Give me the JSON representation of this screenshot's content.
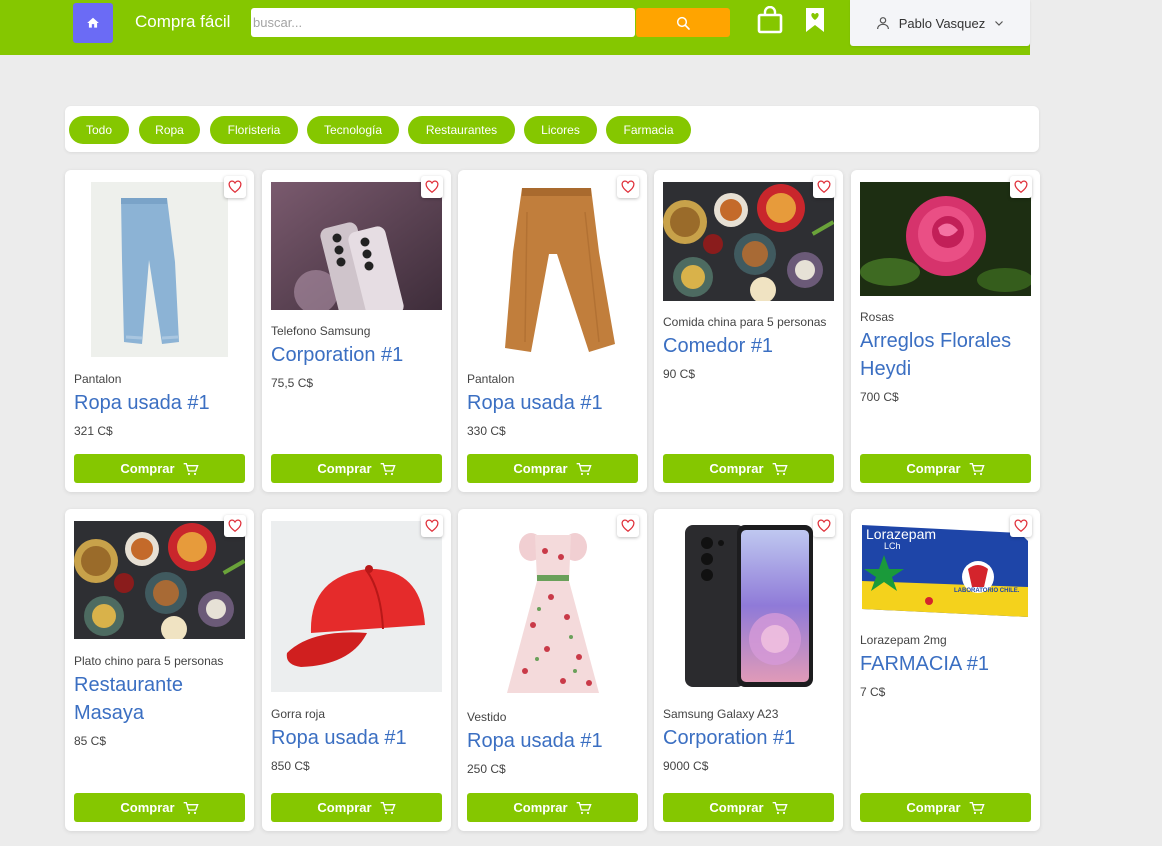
{
  "header": {
    "brand": "Compra fácil",
    "search_placeholder": "buscar...",
    "user_name": "Pablo Vasquez"
  },
  "categories": [
    "Todo",
    "Ropa",
    "Floristeria",
    "Tecnología",
    "Restaurantes",
    "Licores",
    "Farmacia"
  ],
  "products": [
    {
      "category": "Pantalon",
      "store": "Ropa usada #1",
      "price": "321 C$",
      "buy": "Comprar"
    },
    {
      "category": "Telefono Samsung",
      "store": "Corporation #1",
      "price": "75,5 C$",
      "buy": "Comprar"
    },
    {
      "category": "Pantalon",
      "store": "Ropa usada #1",
      "price": "330 C$",
      "buy": "Comprar"
    },
    {
      "category": "Comida china para 5 personas",
      "store": "Comedor #1",
      "price": "90 C$",
      "buy": "Comprar"
    },
    {
      "category": "Rosas",
      "store": "Arreglos Florales Heydi",
      "price": "700 C$",
      "buy": "Comprar"
    },
    {
      "category": "Plato chino para 5 personas",
      "store": "Restaurante Masaya",
      "price": "85 C$",
      "buy": "Comprar"
    },
    {
      "category": "Gorra roja",
      "store": "Ropa usada #1",
      "price": "850 C$",
      "buy": "Comprar"
    },
    {
      "category": "Vestido",
      "store": "Ropa usada #1",
      "price": "250 C$",
      "buy": "Comprar"
    },
    {
      "category": "Samsung Galaxy A23",
      "store": "Corporation #1",
      "price": "9000 C$",
      "buy": "Comprar"
    },
    {
      "category": "Lorazepam 2mg",
      "store": "FARMACIA #1",
      "price": "7 C$",
      "buy": "Comprar"
    }
  ],
  "packaging": {
    "name": "Lorazepam",
    "sub": "LCh",
    "lab": "LABORATORIO CHILE."
  },
  "colors": {
    "brand_green": "#85c700",
    "search_orange": "#ffa400",
    "home_purple": "#6b6bf5",
    "link_blue": "#3b6fc2",
    "heart_red": "#e0323c"
  },
  "icons": {
    "home": "home-icon",
    "search": "search-icon",
    "bag": "shopping-bag-icon",
    "bookmark": "bookmark-heart-icon",
    "user": "user-icon",
    "chevron": "chevron-down-icon",
    "heart": "heart-icon",
    "cart": "cart-icon"
  }
}
